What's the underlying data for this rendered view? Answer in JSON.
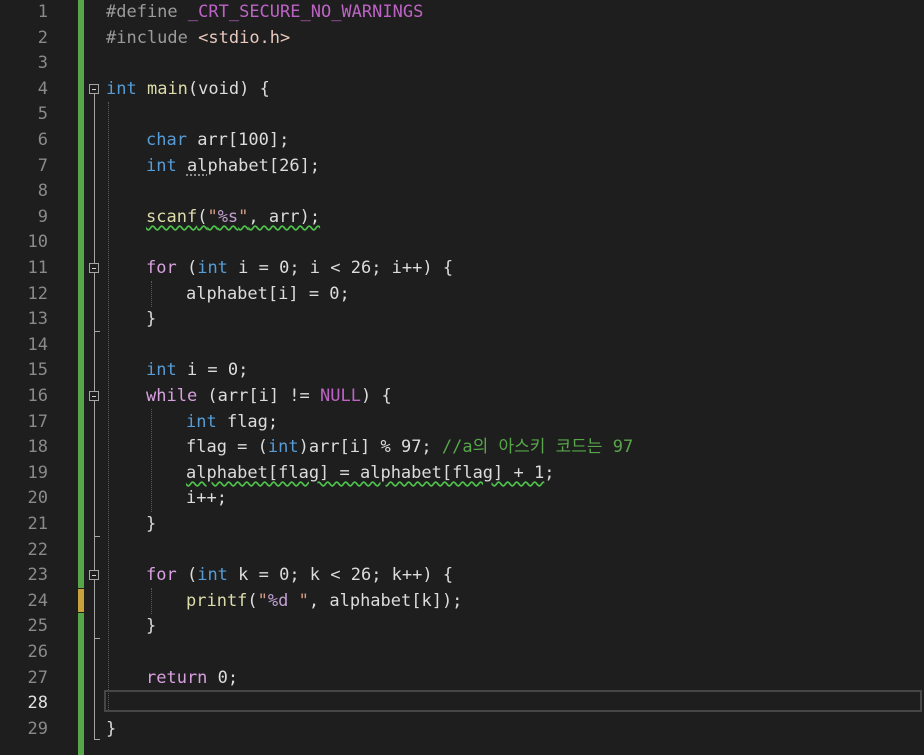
{
  "editor": {
    "current_line": 28,
    "lines": [
      {
        "n": "1",
        "text": "#define _CRT_SECURE_NO_WARNINGS"
      },
      {
        "n": "2",
        "text": "#include <stdio.h>"
      },
      {
        "n": "3",
        "text": ""
      },
      {
        "n": "4",
        "text": "int main(void) {"
      },
      {
        "n": "5",
        "text": ""
      },
      {
        "n": "6",
        "text": "    char arr[100];"
      },
      {
        "n": "7",
        "text": "    int alphabet[26];"
      },
      {
        "n": "8",
        "text": ""
      },
      {
        "n": "9",
        "text": "    scanf(\"%s\", arr);"
      },
      {
        "n": "10",
        "text": ""
      },
      {
        "n": "11",
        "text": "    for (int i = 0; i < 26; i++) {"
      },
      {
        "n": "12",
        "text": "        alphabet[i] = 0;"
      },
      {
        "n": "13",
        "text": "    }"
      },
      {
        "n": "14",
        "text": ""
      },
      {
        "n": "15",
        "text": "    int i = 0;"
      },
      {
        "n": "16",
        "text": "    while (arr[i] != NULL) {"
      },
      {
        "n": "17",
        "text": "        int flag;"
      },
      {
        "n": "18",
        "text": "        flag = (int)arr[i] % 97; //a의 아스키 코드는 97"
      },
      {
        "n": "19",
        "text": "        alphabet[flag] = alphabet[flag] + 1;"
      },
      {
        "n": "20",
        "text": "        i++;"
      },
      {
        "n": "21",
        "text": "    }"
      },
      {
        "n": "22",
        "text": ""
      },
      {
        "n": "23",
        "text": "    for (int k = 0; k < 26; k++) {"
      },
      {
        "n": "24",
        "text": "        printf(\"%d \", alphabet[k]);"
      },
      {
        "n": "25",
        "text": "    }"
      },
      {
        "n": "26",
        "text": ""
      },
      {
        "n": "27",
        "text": "    return 0;"
      },
      {
        "n": "28",
        "text": ""
      },
      {
        "n": "29",
        "text": "}"
      }
    ],
    "tokens": {
      "l1_define": "#define",
      "l1_macro": "_CRT_SECURE_NO_WARNINGS",
      "l2_include": "#include",
      "l2_header": "<stdio.h>",
      "l4_int": "int",
      "l4_main": "main",
      "l4_rest": "(void) {",
      "l6_char": "char",
      "l6_rest": " arr[100];",
      "l7_int": "int",
      "l7_space": " ",
      "l7_a": "al",
      "l7_rest": "phabet[26];",
      "l9_scanf": "scanf",
      "l9_open": "(",
      "l9_q1": "\"",
      "l9_fmt": "%s",
      "l9_q2": "\"",
      "l9_rest": ", arr);",
      "l11_for": "for",
      "l11_a": " (",
      "l11_int": "int",
      "l11_b": " i = 0; i < 26; i++) {",
      "l12": "alphabet[i] = 0;",
      "l13": "}",
      "l15_int": "int",
      "l15_rest": " i = 0;",
      "l16_while": "while",
      "l16_a": " (arr[i] != ",
      "l16_null": "NULL",
      "l16_b": ") {",
      "l17_int": "int",
      "l17_rest": " flag;",
      "l18_a": "flag = (",
      "l18_int": "int",
      "l18_b": ")arr[i] % 97; ",
      "l18_cmt": "//a의 아스키 코드는 97",
      "l19": "alphabet[flag] = alphabet[flag] + 1",
      "l19_end": ";",
      "l20": "i++;",
      "l21": "}",
      "l23_for": "for",
      "l23_a": " (",
      "l23_int": "int",
      "l23_b": " k = 0; k < 26; k++) {",
      "l24_printf": "printf",
      "l24_open": "(",
      "l24_q1": "\"",
      "l24_fmt": "%d",
      "l24_q2": " \"",
      "l24_rest": ", alphabet[k]);",
      "l25": "}",
      "l27_return": "return",
      "l27_rest": " 0;",
      "l29": "}"
    }
  }
}
